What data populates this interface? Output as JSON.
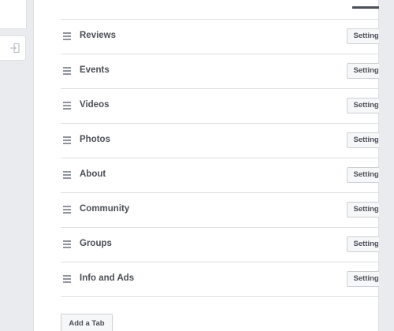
{
  "sidebar": {
    "icon": "sign-in-icon"
  },
  "tabs": [
    {
      "label": "Reviews",
      "settings_label": "Settings"
    },
    {
      "label": "Events",
      "settings_label": "Settings"
    },
    {
      "label": "Videos",
      "settings_label": "Settings"
    },
    {
      "label": "Photos",
      "settings_label": "Settings"
    },
    {
      "label": "About",
      "settings_label": "Settings"
    },
    {
      "label": "Community",
      "settings_label": "Settings"
    },
    {
      "label": "Groups",
      "settings_label": "Settings"
    },
    {
      "label": "Info and Ads",
      "settings_label": "Settings"
    }
  ],
  "footer": {
    "add_tab_label": "Add a Tab"
  },
  "colors": {
    "background": "#e9ebee",
    "panel": "#ffffff",
    "text": "#4b4f56",
    "border": "#dddfe2",
    "button_bg": "#f6f7f9"
  }
}
